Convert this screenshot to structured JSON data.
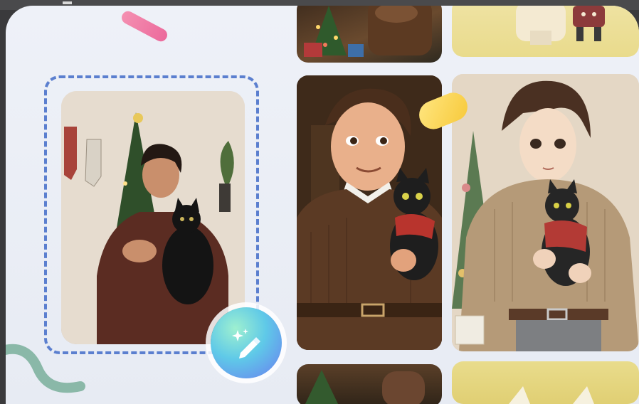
{
  "colors": {
    "frame_dash": "#5b7fcf",
    "background": "#eef1f8",
    "accent_pink": "#f48fb1",
    "accent_yellow": "#f7c93a"
  },
  "icons": {
    "magic_edit": "sparkle-pencil-icon"
  },
  "gallery": {
    "original_photo": "original-photo",
    "generated_styles": [
      "3d-cartoon-style",
      "anime-illustration-style"
    ]
  }
}
